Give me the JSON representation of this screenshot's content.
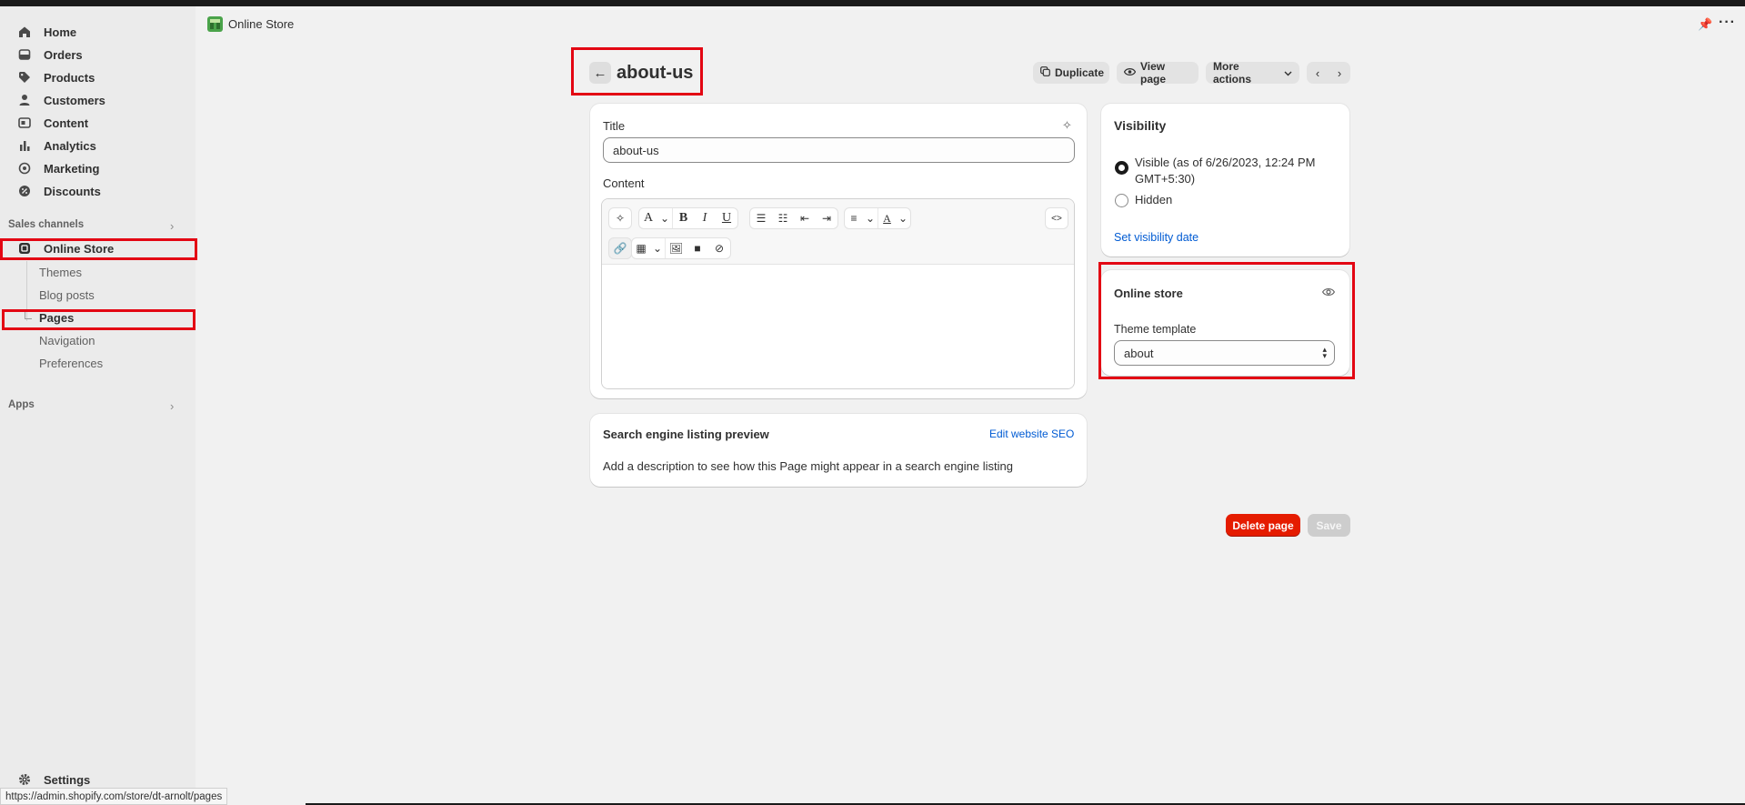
{
  "sidebar": {
    "main_items": [
      {
        "label": "Home",
        "icon": "home-icon"
      },
      {
        "label": "Orders",
        "icon": "orders-icon"
      },
      {
        "label": "Products",
        "icon": "tag-icon"
      },
      {
        "label": "Customers",
        "icon": "person-icon"
      },
      {
        "label": "Content",
        "icon": "content-icon"
      },
      {
        "label": "Analytics",
        "icon": "bar-chart-icon"
      },
      {
        "label": "Marketing",
        "icon": "target-icon"
      },
      {
        "label": "Discounts",
        "icon": "discount-icon"
      }
    ],
    "sales_channels_label": "Sales channels",
    "online_store_label": "Online Store",
    "sub_items": [
      "Themes",
      "Blog posts",
      "Pages",
      "Navigation",
      "Preferences"
    ],
    "apps_label": "Apps",
    "settings_label": "Settings"
  },
  "header": {
    "store_title": "Online Store"
  },
  "page": {
    "title": "about-us",
    "duplicate_label": "Duplicate",
    "view_page_label": "View page",
    "more_actions_label": "More actions"
  },
  "main_card": {
    "title_label": "Title",
    "title_value": "about-us",
    "content_label": "Content"
  },
  "seo_card": {
    "title": "Search engine listing preview",
    "edit_link": "Edit website SEO",
    "description": "Add a description to see how this Page might appear in a search engine listing"
  },
  "visibility_card": {
    "title": "Visibility",
    "visible_label_line1": "Visible (as of 6/26/2023, 12:24 PM",
    "visible_label_line2": "GMT+5:30)",
    "hidden_label": "Hidden",
    "set_date_link": "Set visibility date"
  },
  "online_store_card": {
    "title": "Online store",
    "template_label": "Theme template",
    "template_value": "about"
  },
  "footer": {
    "delete_label": "Delete page",
    "save_label": "Save"
  },
  "status_bar": {
    "url": "https://admin.shopify.com/store/dt-arnolt/pages"
  },
  "colors": {
    "highlight": "#e30613",
    "danger": "#e51c00",
    "link": "#005bd3"
  }
}
